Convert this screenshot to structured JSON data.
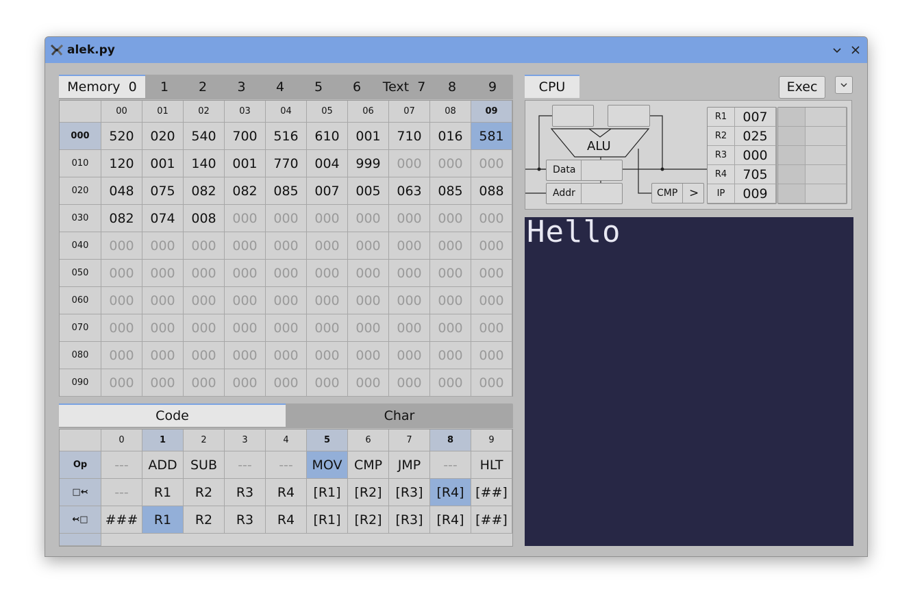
{
  "window": {
    "title": "alek.py"
  },
  "memory_tabs": {
    "label": "Memory",
    "pages": [
      "0",
      "1",
      "2",
      "3",
      "4",
      "5",
      "6",
      "7",
      "8",
      "9"
    ],
    "text_label": "Text"
  },
  "memory": {
    "col_headers": [
      "00",
      "01",
      "02",
      "03",
      "04",
      "05",
      "06",
      "07",
      "08",
      "09"
    ],
    "row_headers": [
      "000",
      "010",
      "020",
      "030",
      "040",
      "050",
      "060",
      "070",
      "080",
      "090"
    ],
    "rows": [
      [
        "520",
        "020",
        "540",
        "700",
        "516",
        "610",
        "001",
        "710",
        "016",
        "581"
      ],
      [
        "120",
        "001",
        "140",
        "001",
        "770",
        "004",
        "999",
        "000",
        "000",
        "000"
      ],
      [
        "048",
        "075",
        "082",
        "082",
        "085",
        "007",
        "005",
        "063",
        "085",
        "088"
      ],
      [
        "082",
        "074",
        "008",
        "000",
        "000",
        "000",
        "000",
        "000",
        "000",
        "000"
      ],
      [
        "000",
        "000",
        "000",
        "000",
        "000",
        "000",
        "000",
        "000",
        "000",
        "000"
      ],
      [
        "000",
        "000",
        "000",
        "000",
        "000",
        "000",
        "000",
        "000",
        "000",
        "000"
      ],
      [
        "000",
        "000",
        "000",
        "000",
        "000",
        "000",
        "000",
        "000",
        "000",
        "000"
      ],
      [
        "000",
        "000",
        "000",
        "000",
        "000",
        "000",
        "000",
        "000",
        "000",
        "000"
      ],
      [
        "000",
        "000",
        "000",
        "000",
        "000",
        "000",
        "000",
        "000",
        "000",
        "000"
      ],
      [
        "000",
        "000",
        "000",
        "000",
        "000",
        "000",
        "000",
        "000",
        "000",
        "000"
      ]
    ]
  },
  "code_tabs": [
    "Code",
    "Char"
  ],
  "code": {
    "col_headers": [
      "0",
      "1",
      "2",
      "3",
      "4",
      "5",
      "6",
      "7",
      "8",
      "9"
    ],
    "row_headers": [
      "Op",
      "□↢",
      "↢□"
    ],
    "rows": [
      [
        "---",
        "ADD",
        "SUB",
        "---",
        "---",
        "MOV",
        "CMP",
        "JMP",
        "---",
        "HLT"
      ],
      [
        "---",
        "R1",
        "R2",
        "R3",
        "R4",
        "[R1]",
        "[R2]",
        "[R3]",
        "[R4]",
        "[##]"
      ],
      [
        "###",
        "R1",
        "R2",
        "R3",
        "R4",
        "[R1]",
        "[R2]",
        "[R3]",
        "[R4]",
        "[##]"
      ]
    ]
  },
  "cpu": {
    "tab_label": "CPU",
    "exec_label": "Exec",
    "dropdown_glyph": "⌄",
    "alu_label": "ALU",
    "data_label": "Data",
    "addr_label": "Addr",
    "cmp_label": "CMP",
    "cmp_value": ">",
    "registers": [
      {
        "name": "R1",
        "value": "007"
      },
      {
        "name": "R2",
        "value": "025"
      },
      {
        "name": "R3",
        "value": "000"
      },
      {
        "name": "R4",
        "value": "705"
      },
      {
        "name": "IP",
        "value": "009"
      }
    ]
  },
  "screen": {
    "text": "Hello"
  },
  "colors": {
    "titlebar": "#7aa2e2",
    "highlight": "#93afd8",
    "screen_bg": "#272745"
  }
}
